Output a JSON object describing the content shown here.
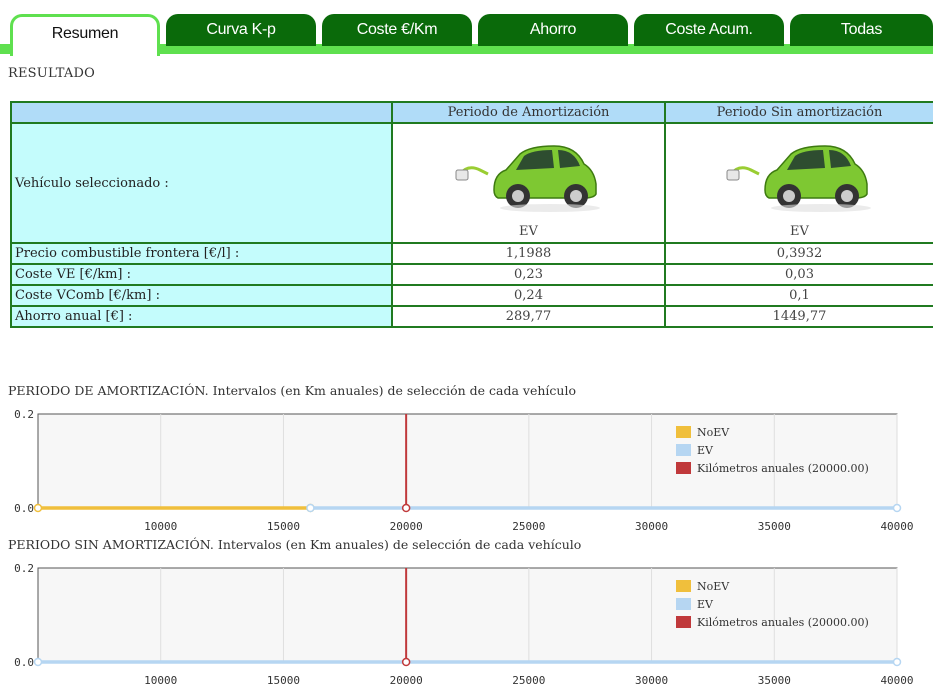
{
  "tabs": [
    {
      "label": "Resumen",
      "active": true
    },
    {
      "label": "Curva K-p",
      "active": false
    },
    {
      "label": "Coste €/Km",
      "active": false
    },
    {
      "label": "Ahorro",
      "active": false
    },
    {
      "label": "Coste Acum.",
      "active": false
    },
    {
      "label": "Todas",
      "active": false
    }
  ],
  "result_title": "RESULTADO",
  "table": {
    "headers": [
      "Periodo de Amortización",
      "Periodo Sin amortización"
    ],
    "vehicle_label": "Vehículo seleccionado :",
    "vehicles": [
      "EV",
      "EV"
    ],
    "rows": [
      {
        "label": "Precio combustible frontera [€/l] :",
        "values": [
          "1,1988",
          "0,3932"
        ]
      },
      {
        "label": "Coste VE [€/km] :",
        "values": [
          "0,23",
          "0,03"
        ]
      },
      {
        "label": "Coste VComb [€/km] :",
        "values": [
          "0,24",
          "0,1"
        ]
      },
      {
        "label": "Ahorro anual [€] :",
        "values": [
          "289,77",
          "1449,77"
        ]
      }
    ]
  },
  "colors": {
    "noev": "#f0bf3c",
    "ev": "#b6d6f2",
    "km_line": "#c0393b",
    "tab_green": "#0a6a0a",
    "tab_line": "#5fe04f"
  },
  "chart_data": [
    {
      "type": "line",
      "title": "PERIODO DE AMORTIZACIÓN. Intervalos (en Km anuales) de selección de cada vehículo",
      "xlim": [
        5000,
        40000
      ],
      "ylim": [
        0,
        0.2
      ],
      "x_ticks": [
        "10000",
        "15000",
        "20000",
        "25000",
        "30000",
        "35000",
        "40000"
      ],
      "y_ticks": [
        "0.0",
        "0.2"
      ],
      "legend_position": "top-right",
      "series": [
        {
          "name": "NoEV",
          "color": "#f0bf3c",
          "x": [
            5000,
            16100
          ],
          "y": [
            0,
            0
          ]
        },
        {
          "name": "EV",
          "color": "#b6d6f2",
          "x": [
            16100,
            40000
          ],
          "y": [
            0,
            0
          ]
        },
        {
          "name": "Kilómetros anuales (20000.00)",
          "color": "#c0393b",
          "vertical_at": 20000
        }
      ]
    },
    {
      "type": "line",
      "title": "PERIODO SIN AMORTIZACIÓN. Intervalos (en Km anuales) de selección de cada vehículo",
      "xlim": [
        5000,
        40000
      ],
      "ylim": [
        0,
        0.2
      ],
      "x_ticks": [
        "10000",
        "15000",
        "20000",
        "25000",
        "30000",
        "35000",
        "40000"
      ],
      "y_ticks": [
        "0.0",
        "0.2"
      ],
      "legend_position": "top-right",
      "series": [
        {
          "name": "NoEV",
          "color": "#f0bf3c",
          "x": [],
          "y": []
        },
        {
          "name": "EV",
          "color": "#b6d6f2",
          "x": [
            5000,
            40000
          ],
          "y": [
            0,
            0
          ]
        },
        {
          "name": "Kilómetros anuales (20000.00)",
          "color": "#c0393b",
          "vertical_at": 20000
        }
      ]
    }
  ]
}
